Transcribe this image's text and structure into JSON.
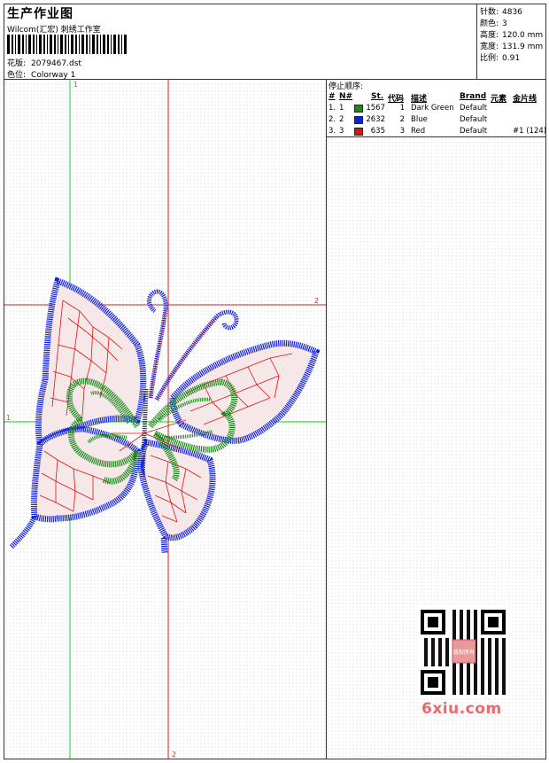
{
  "header": {
    "title": "生产作业图",
    "company": "Wilcom(汇宏) 刺绣工作室",
    "pattern_label": "花版:",
    "pattern_value": "2079467.dst",
    "colorway_label": "色位:",
    "colorway_value": "Colorway 1"
  },
  "stats": {
    "stitches_label": "针数:",
    "stitches_value": "4836",
    "colors_label": "颜色:",
    "colors_value": "3",
    "height_label": "高度:",
    "height_value": "120.0 mm",
    "width_label": "宽度:",
    "width_value": "131.9 mm",
    "scale_label": "比例:",
    "scale_value": "0.91"
  },
  "guides": {
    "green_top": "1",
    "green_side": "1",
    "red_side": "2",
    "red_bottom": "2"
  },
  "stop_sequence": {
    "title": "停止顺序:",
    "headers": {
      "hash": "#",
      "num": "N#",
      "stitches": "St.",
      "code": "代码",
      "description": "描述",
      "brand": "Brand",
      "element": "元素",
      "sequin": "金片线"
    },
    "rows": [
      {
        "idx": "1.",
        "num": "1",
        "color": "#1a8a1a",
        "stitches": "1567",
        "code": "1",
        "description": "Dark Green",
        "brand": "Default",
        "sequin": ""
      },
      {
        "idx": "2.",
        "num": "2",
        "color": "#1020e0",
        "stitches": "2632",
        "code": "2",
        "description": "Blue",
        "brand": "Default",
        "sequin": ""
      },
      {
        "idx": "3.",
        "num": "3",
        "color": "#e01010",
        "stitches": "635",
        "code": "3",
        "description": "Red",
        "brand": "Default",
        "sequin": "#1 (124)"
      }
    ]
  },
  "watermark": "6xiu.com",
  "qr_stamp": "版权所有"
}
